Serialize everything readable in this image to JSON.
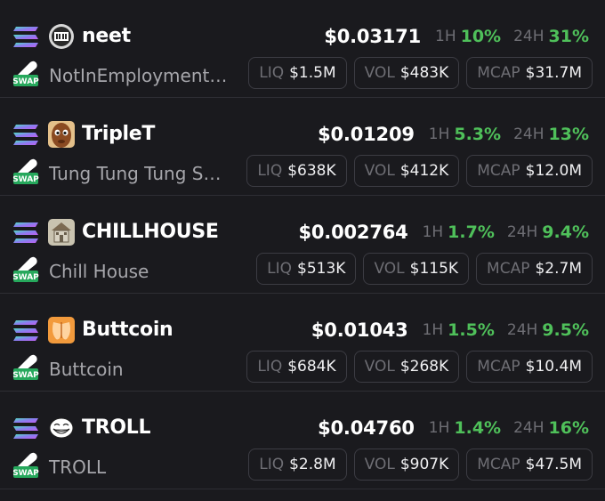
{
  "labels": {
    "h1": "1H",
    "h24": "24H",
    "liq": "LIQ",
    "vol": "VOL",
    "mcap": "MCAP",
    "swap": "SWAP"
  },
  "colors": {
    "positive": "#4fc05a",
    "muted": "#6e6e74",
    "background": "#1a1a1e"
  },
  "tokens": [
    {
      "symbol": "neet",
      "name": "NotInEmployment…",
      "price": "$0.03171",
      "change_1h": "10%",
      "change_24h": "31%",
      "liq": "$1.5M",
      "vol": "$483K",
      "mcap": "$31.7M",
      "avatar_icon": "neet-logo-icon"
    },
    {
      "symbol": "TripleT",
      "name": "Tung Tung Tung S…",
      "price": "$0.01209",
      "change_1h": "5.3%",
      "change_24h": "13%",
      "liq": "$638K",
      "vol": "$412K",
      "mcap": "$12.0M",
      "avatar_icon": "wooden-figure-icon"
    },
    {
      "symbol": "CHILLHOUSE",
      "name": "Chill House",
      "price": "$0.002764",
      "change_1h": "1.7%",
      "change_24h": "9.4%",
      "liq": "$513K",
      "vol": "$115K",
      "mcap": "$2.7M",
      "avatar_icon": "house-icon"
    },
    {
      "symbol": "Buttcoin",
      "name": "Buttcoin",
      "price": "$0.01043",
      "change_1h": "1.5%",
      "change_24h": "9.5%",
      "liq": "$684K",
      "vol": "$268K",
      "mcap": "$10.4M",
      "avatar_icon": "buttcoin-logo-icon"
    },
    {
      "symbol": "TROLL",
      "name": "TROLL",
      "price": "$0.04760",
      "change_1h": "1.4%",
      "change_24h": "16%",
      "liq": "$2.8M",
      "vol": "$907K",
      "mcap": "$47.5M",
      "avatar_icon": "trollface-icon"
    }
  ]
}
